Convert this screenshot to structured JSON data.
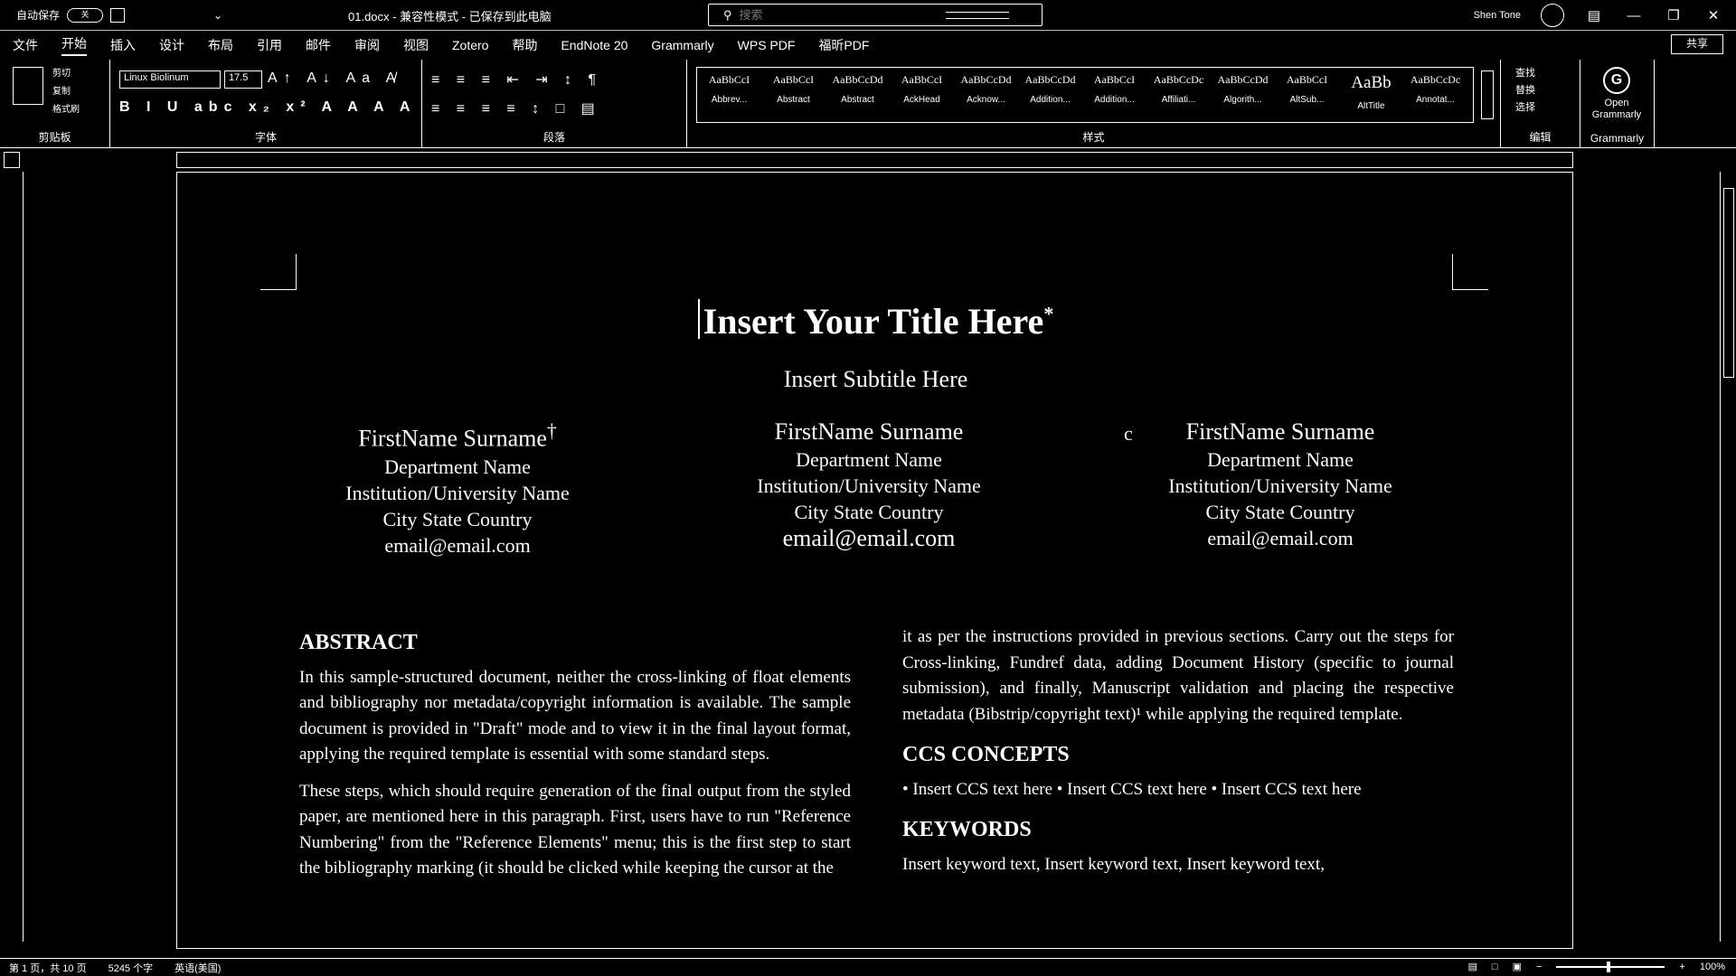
{
  "titlebar": {
    "autosave_label": "自动保存",
    "autosave_state": "关",
    "qa_more": "⌄",
    "doc_title": "01.docx - 兼容性模式 - 已保存到此电脑",
    "search_placeholder": "搜索",
    "user": "Shen Tone",
    "minimize": "—",
    "restore": "❐",
    "close": "✕"
  },
  "menu": {
    "tabs": [
      "文件",
      "开始",
      "插入",
      "设计",
      "布局",
      "引用",
      "邮件",
      "审阅",
      "视图",
      "Zotero",
      "帮助",
      "EndNote 20",
      "Grammarly",
      "WPS PDF",
      "福昕PDF"
    ],
    "share": "共享"
  },
  "ribbon": {
    "groups": {
      "clipboard": "剪贴板",
      "font": "字体",
      "paragraph": "段落",
      "styles": "样式",
      "editing": "编辑",
      "grammarly": "Grammarly"
    },
    "clipboard": {
      "paste": "粘贴",
      "cut": "剪切",
      "copy": "复制",
      "format_painter": "格式刷"
    },
    "font": {
      "name": "Linux Biolinum",
      "size": "17.5"
    },
    "styles": [
      {
        "sample": "AaBbCcI",
        "name": "Abbrev..."
      },
      {
        "sample": "AaBbCcI",
        "name": "Abstract"
      },
      {
        "sample": "AaBbCcDd",
        "name": "Abstract"
      },
      {
        "sample": "AaBbCcI",
        "name": "AckHead"
      },
      {
        "sample": "AaBbCcDd",
        "name": "Acknow..."
      },
      {
        "sample": "AaBbCcDd",
        "name": "Addition..."
      },
      {
        "sample": "AaBbCcI",
        "name": "Addition..."
      },
      {
        "sample": "AaBbCcDc",
        "name": "Affiliati..."
      },
      {
        "sample": "AaBbCcDd",
        "name": "Algorith..."
      },
      {
        "sample": "AaBbCcI",
        "name": "AltSub..."
      },
      {
        "sample": "AaBb",
        "name": "AltTitle"
      },
      {
        "sample": "AaBbCcDc",
        "name": "Annotat..."
      }
    ],
    "editing": [
      "查找",
      "替换",
      "选择"
    ],
    "grammarly": {
      "icon": "G",
      "label": "Open Grammarly"
    }
  },
  "document": {
    "title": "Insert Your Title Here",
    "title_mark": "*",
    "subtitle": "Insert Subtitle Here",
    "authors": [
      {
        "name": "FirstName Surname",
        "mark": "†",
        "department": "Department Name",
        "institution": "Institution/University Name",
        "location": "City State Country",
        "email": "email@email.com"
      },
      {
        "name": "FirstName Surname",
        "mark": "",
        "department": "Department Name",
        "institution": "Institution/University Name",
        "location": "City State Country",
        "email": "email@email.com"
      },
      {
        "name": "FirstName Surname",
        "mark": "",
        "department": "Department Name",
        "institution": "Institution/University Name",
        "location": "City State Country",
        "email": "email@email.com"
      }
    ],
    "marker_c": "c",
    "abstract_heading": "ABSTRACT",
    "abstract_p1": "In this sample-structured document, neither the cross-linking of float elements and bibliography nor metadata/copyright information is available. The sample document is provided in \"Draft\" mode and to view it in the final layout format, applying the required template is essential with some standard steps.",
    "abstract_p2": "These steps, which should require generation of the final output from the styled paper, are mentioned here in this paragraph. First, users have to run \"Reference Numbering\" from the \"Reference Elements\" menu; this is the first step to start the bibliography marking (it should be clicked while keeping the cursor at the",
    "right_p1": "it as per the instructions provided in previous sections. Carry out the steps for Cross-linking, Fundref data, adding Document History (specific to journal submission), and finally, Manuscript validation and placing the respective metadata (Bibstrip/copyright text)¹ while applying the required template.",
    "ccs_heading": "CCS CONCEPTS",
    "ccs_text": "• Insert CCS text here • Insert CCS text here • Insert CCS text here",
    "keywords_heading": "KEYWORDS",
    "keywords_text": "Insert keyword text, Insert keyword text, Insert keyword text,"
  },
  "status": {
    "page": "第 1 页，共 10 页",
    "words": "5245 个字",
    "language": "英语(美国)",
    "zoom": "100%"
  }
}
